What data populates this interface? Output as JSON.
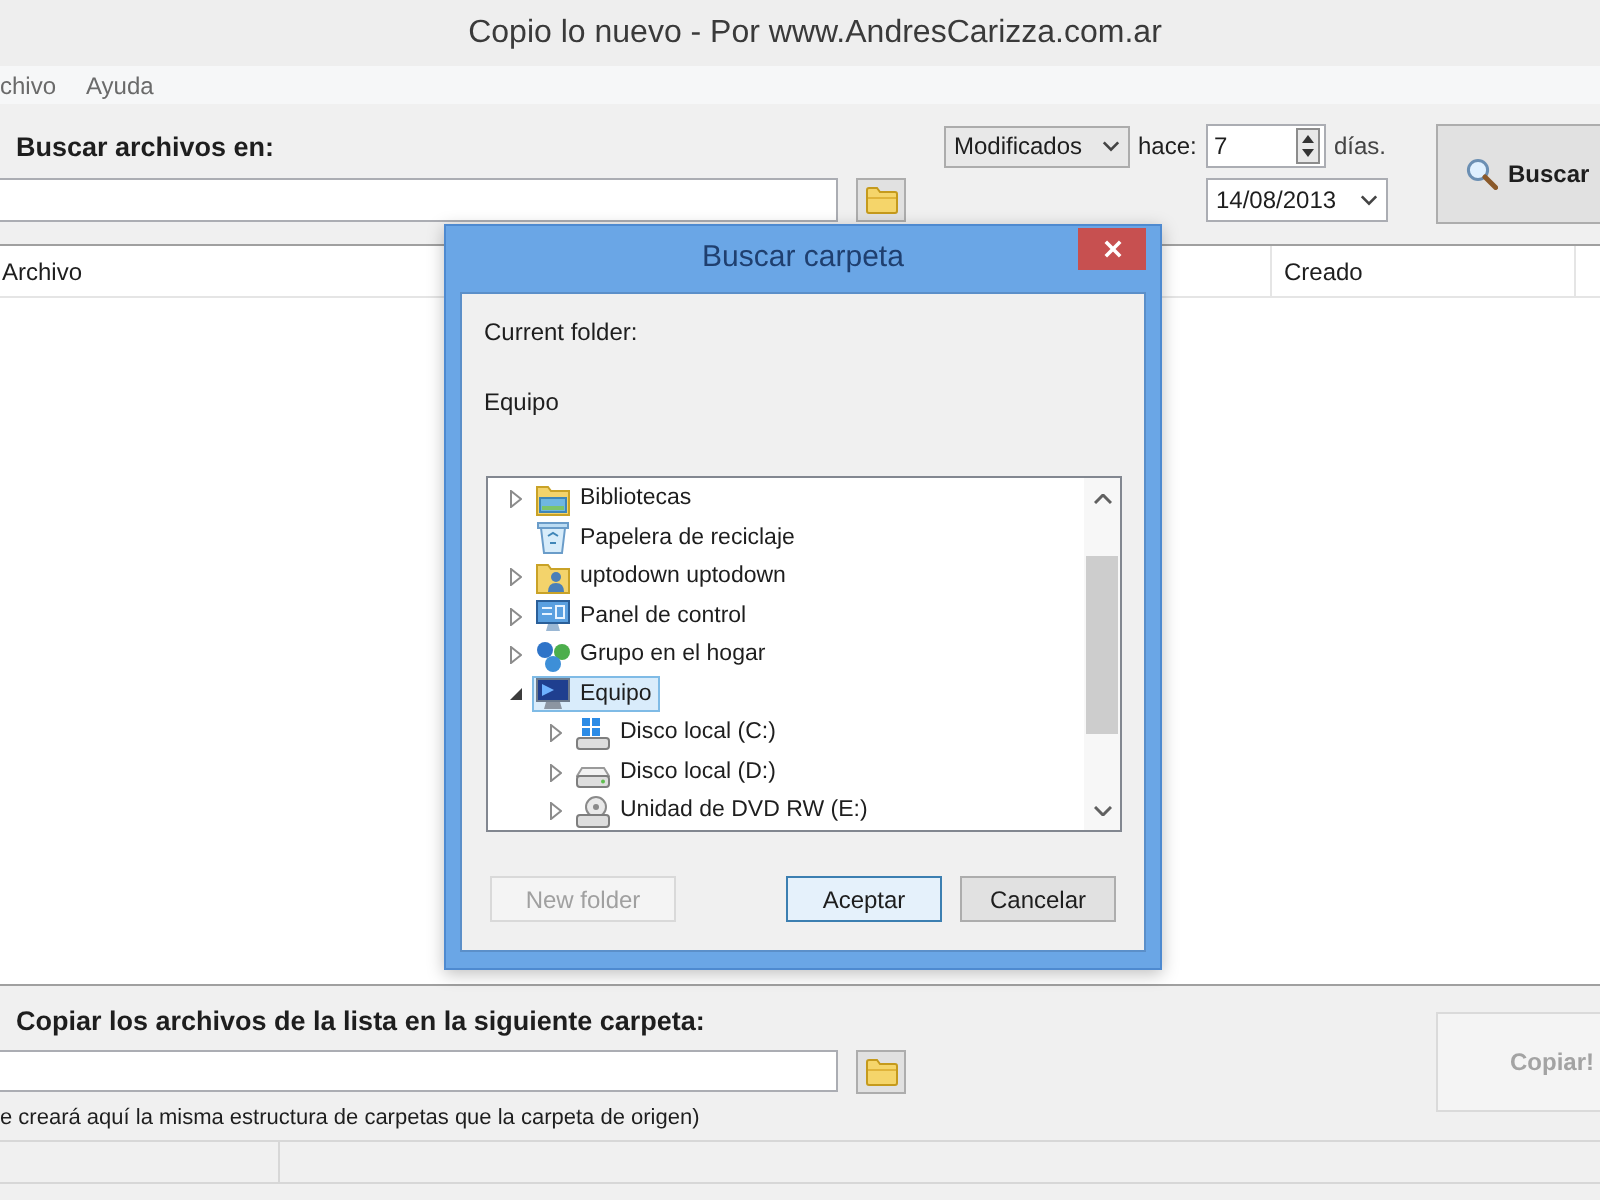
{
  "window": {
    "title": "Copio lo nuevo - Por www.AndresCarizza.com.ar"
  },
  "menu": [
    {
      "label": "chivo"
    },
    {
      "label": "Ayuda"
    }
  ],
  "search": {
    "label": "Buscar archivos en:",
    "filter": "Modificados",
    "ago_label": "hace:",
    "days": "7",
    "days_label": "días.",
    "date": "14/08/2013",
    "button": {
      "label": "Buscar",
      "disabled": false
    }
  },
  "file_list": {
    "columns": [
      "Archivo",
      "Creado"
    ]
  },
  "copy": {
    "label": "Copiar los archivos de la lista en la siguiente carpeta:",
    "note": "e creará aquí la misma estructura de carpetas que la carpeta de origen)",
    "button": {
      "label": "Copiar!",
      "disabled": true
    }
  },
  "dialog": {
    "title": "Buscar carpeta",
    "current_folder_label": "Current folder:",
    "current_folder": "Equipo",
    "tree": [
      {
        "label": "Bibliotecas",
        "kind": "libraries",
        "expanded": false,
        "selected": false
      },
      {
        "label": "Papelera de reciclaje",
        "kind": "recycle-bin",
        "selected": false
      },
      {
        "label": "uptodown uptodown",
        "kind": "user-folder",
        "expanded": false,
        "selected": false
      },
      {
        "label": "Panel de control",
        "kind": "control-panel",
        "expanded": false,
        "selected": false
      },
      {
        "label": "Grupo en el hogar",
        "kind": "homegroup",
        "expanded": false,
        "selected": false
      },
      {
        "label": "Equipo",
        "kind": "computer",
        "expanded": true,
        "selected": true,
        "children": [
          {
            "label": "Disco local (C:)",
            "kind": "system-drive",
            "expanded": false,
            "selected": false
          },
          {
            "label": "Disco local (D:)",
            "kind": "drive",
            "expanded": false,
            "selected": false
          },
          {
            "label": "Unidad de DVD RW (E:)",
            "kind": "dvd-drive",
            "expanded": false,
            "selected": false
          }
        ]
      }
    ],
    "buttons": [
      {
        "label": "New folder",
        "disabled": true,
        "default": false
      },
      {
        "label": "Aceptar",
        "disabled": false,
        "default": true
      },
      {
        "label": "Cancelar",
        "disabled": false,
        "default": false
      }
    ]
  }
}
